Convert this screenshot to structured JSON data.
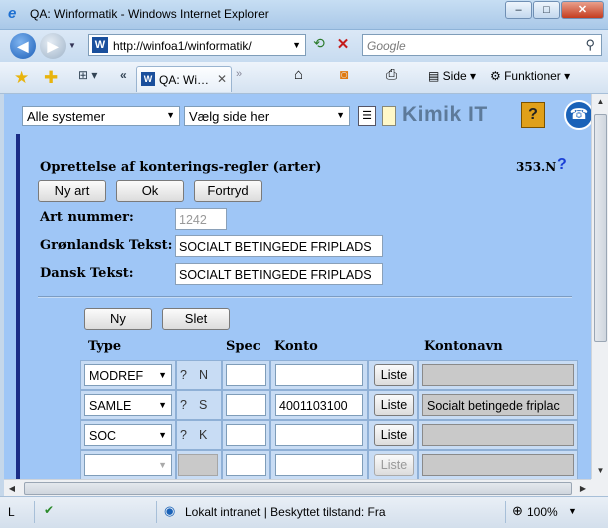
{
  "window": {
    "title": "QA: Winformatik  - Windows Internet Explorer",
    "min": "–",
    "max": "□",
    "close": "✕"
  },
  "address": {
    "url": "http://winfoa1/winformatik/",
    "search_placeholder": "Google"
  },
  "tabs": {
    "active_label": "QA: Wi…"
  },
  "commands": {
    "page": "Side",
    "tools": "Funktioner"
  },
  "topbar": {
    "system_select": "Alle systemer",
    "page_select": "Vælg side her",
    "brand": "Kimik IT",
    "help": "?"
  },
  "form": {
    "title": "Oprettelse af konterings-regler (arter)",
    "page_code": "353.N",
    "page_help": "?",
    "buttons": {
      "ny_art": "Ny art",
      "ok": "Ok",
      "fortryd": "Fortryd",
      "ny": "Ny",
      "slet": "Slet"
    },
    "labels": {
      "art_nummer": "Art nummer:",
      "gronlandsk": "Grønlandsk Tekst:",
      "dansk": "Dansk Tekst:"
    },
    "values": {
      "art_nummer": "1242",
      "gronlandsk": "SOCIALT BETINGEDE FRIPLADS",
      "dansk": "SOCIALT BETINGEDE FRIPLADS"
    }
  },
  "table": {
    "headers": {
      "type": "Type",
      "spec": "Spec",
      "konto": "Konto",
      "kontonavn": "Kontonavn"
    },
    "rows": [
      {
        "type": "MODREF",
        "q": "?",
        "flag": "N",
        "spec": "",
        "konto": "",
        "liste": "Liste",
        "kontonavn": ""
      },
      {
        "type": "SAMLE",
        "q": "?",
        "flag": "S",
        "spec": "",
        "konto": "4001103100",
        "liste": "Liste",
        "kontonavn": "Socialt betingede friplac"
      },
      {
        "type": "SOC",
        "q": "?",
        "flag": "K",
        "spec": "",
        "konto": "",
        "liste": "Liste",
        "kontonavn": ""
      },
      {
        "type": "",
        "q": "",
        "flag": "",
        "spec": "",
        "konto": "",
        "liste": "Liste",
        "kontonavn": ""
      }
    ]
  },
  "status": {
    "left": "L",
    "zone": "Lokalt intranet | Beskyttet tilstand: Fra",
    "zoom": "100%"
  }
}
